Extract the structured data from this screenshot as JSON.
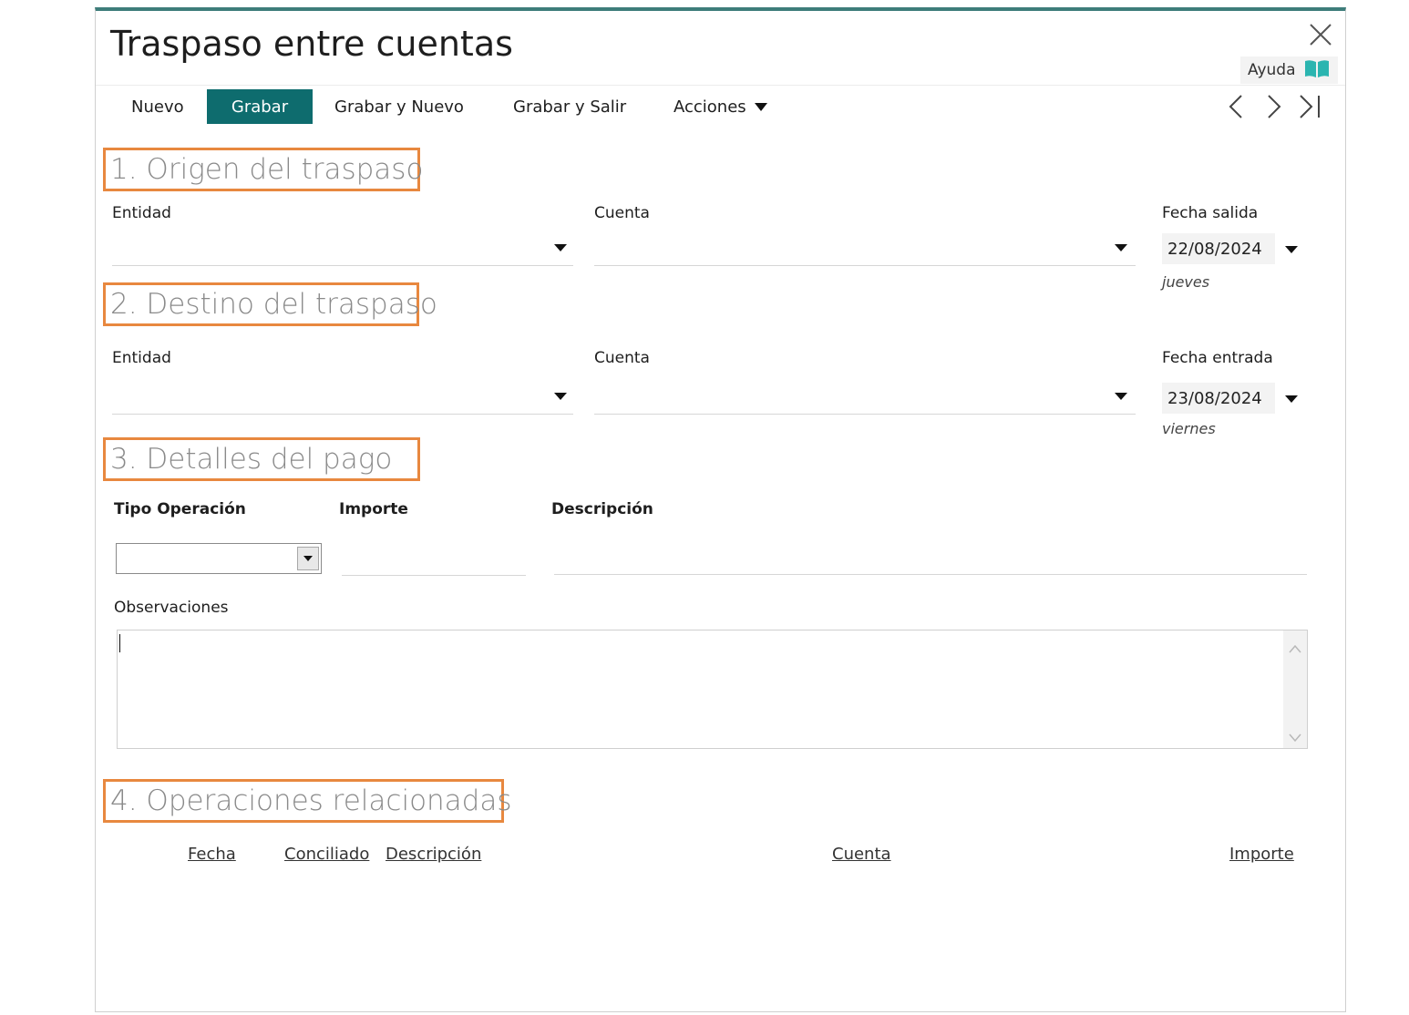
{
  "window": {
    "title": "Traspaso entre cuentas",
    "help_label": "Ayuda"
  },
  "toolbar": {
    "nuevo": "Nuevo",
    "grabar": "Grabar",
    "grabar_nuevo": "Grabar y Nuevo",
    "grabar_salir": "Grabar y Salir",
    "acciones": "Acciones"
  },
  "origen": {
    "heading": "1. Origen del traspaso",
    "entidad_label": "Entidad",
    "cuenta_label": "Cuenta",
    "fecha_label": "Fecha salida",
    "fecha_value": "22/08/2024",
    "day_name": "jueves"
  },
  "destino": {
    "heading": "2. Destino del traspaso",
    "entidad_label": "Entidad",
    "cuenta_label": "Cuenta",
    "fecha_label": "Fecha entrada",
    "fecha_value": "23/08/2024",
    "day_name": "viernes"
  },
  "pago": {
    "heading": "3. Detalles del pago",
    "tipo_label": "Tipo Operación",
    "importe_label": "Importe",
    "descripcion_label": "Descripción",
    "observaciones_label": "Observaciones"
  },
  "operaciones": {
    "heading": "4. Operaciones relacionadas",
    "columns": [
      "Fecha",
      "Conciliado",
      "Descripción",
      "Cuenta",
      "Importe"
    ]
  },
  "colors": {
    "accent": "#0e6c6e",
    "top_border": "#3e7d7a",
    "section_highlight": "#e8883f",
    "help_icon": "#2bb5b0"
  }
}
